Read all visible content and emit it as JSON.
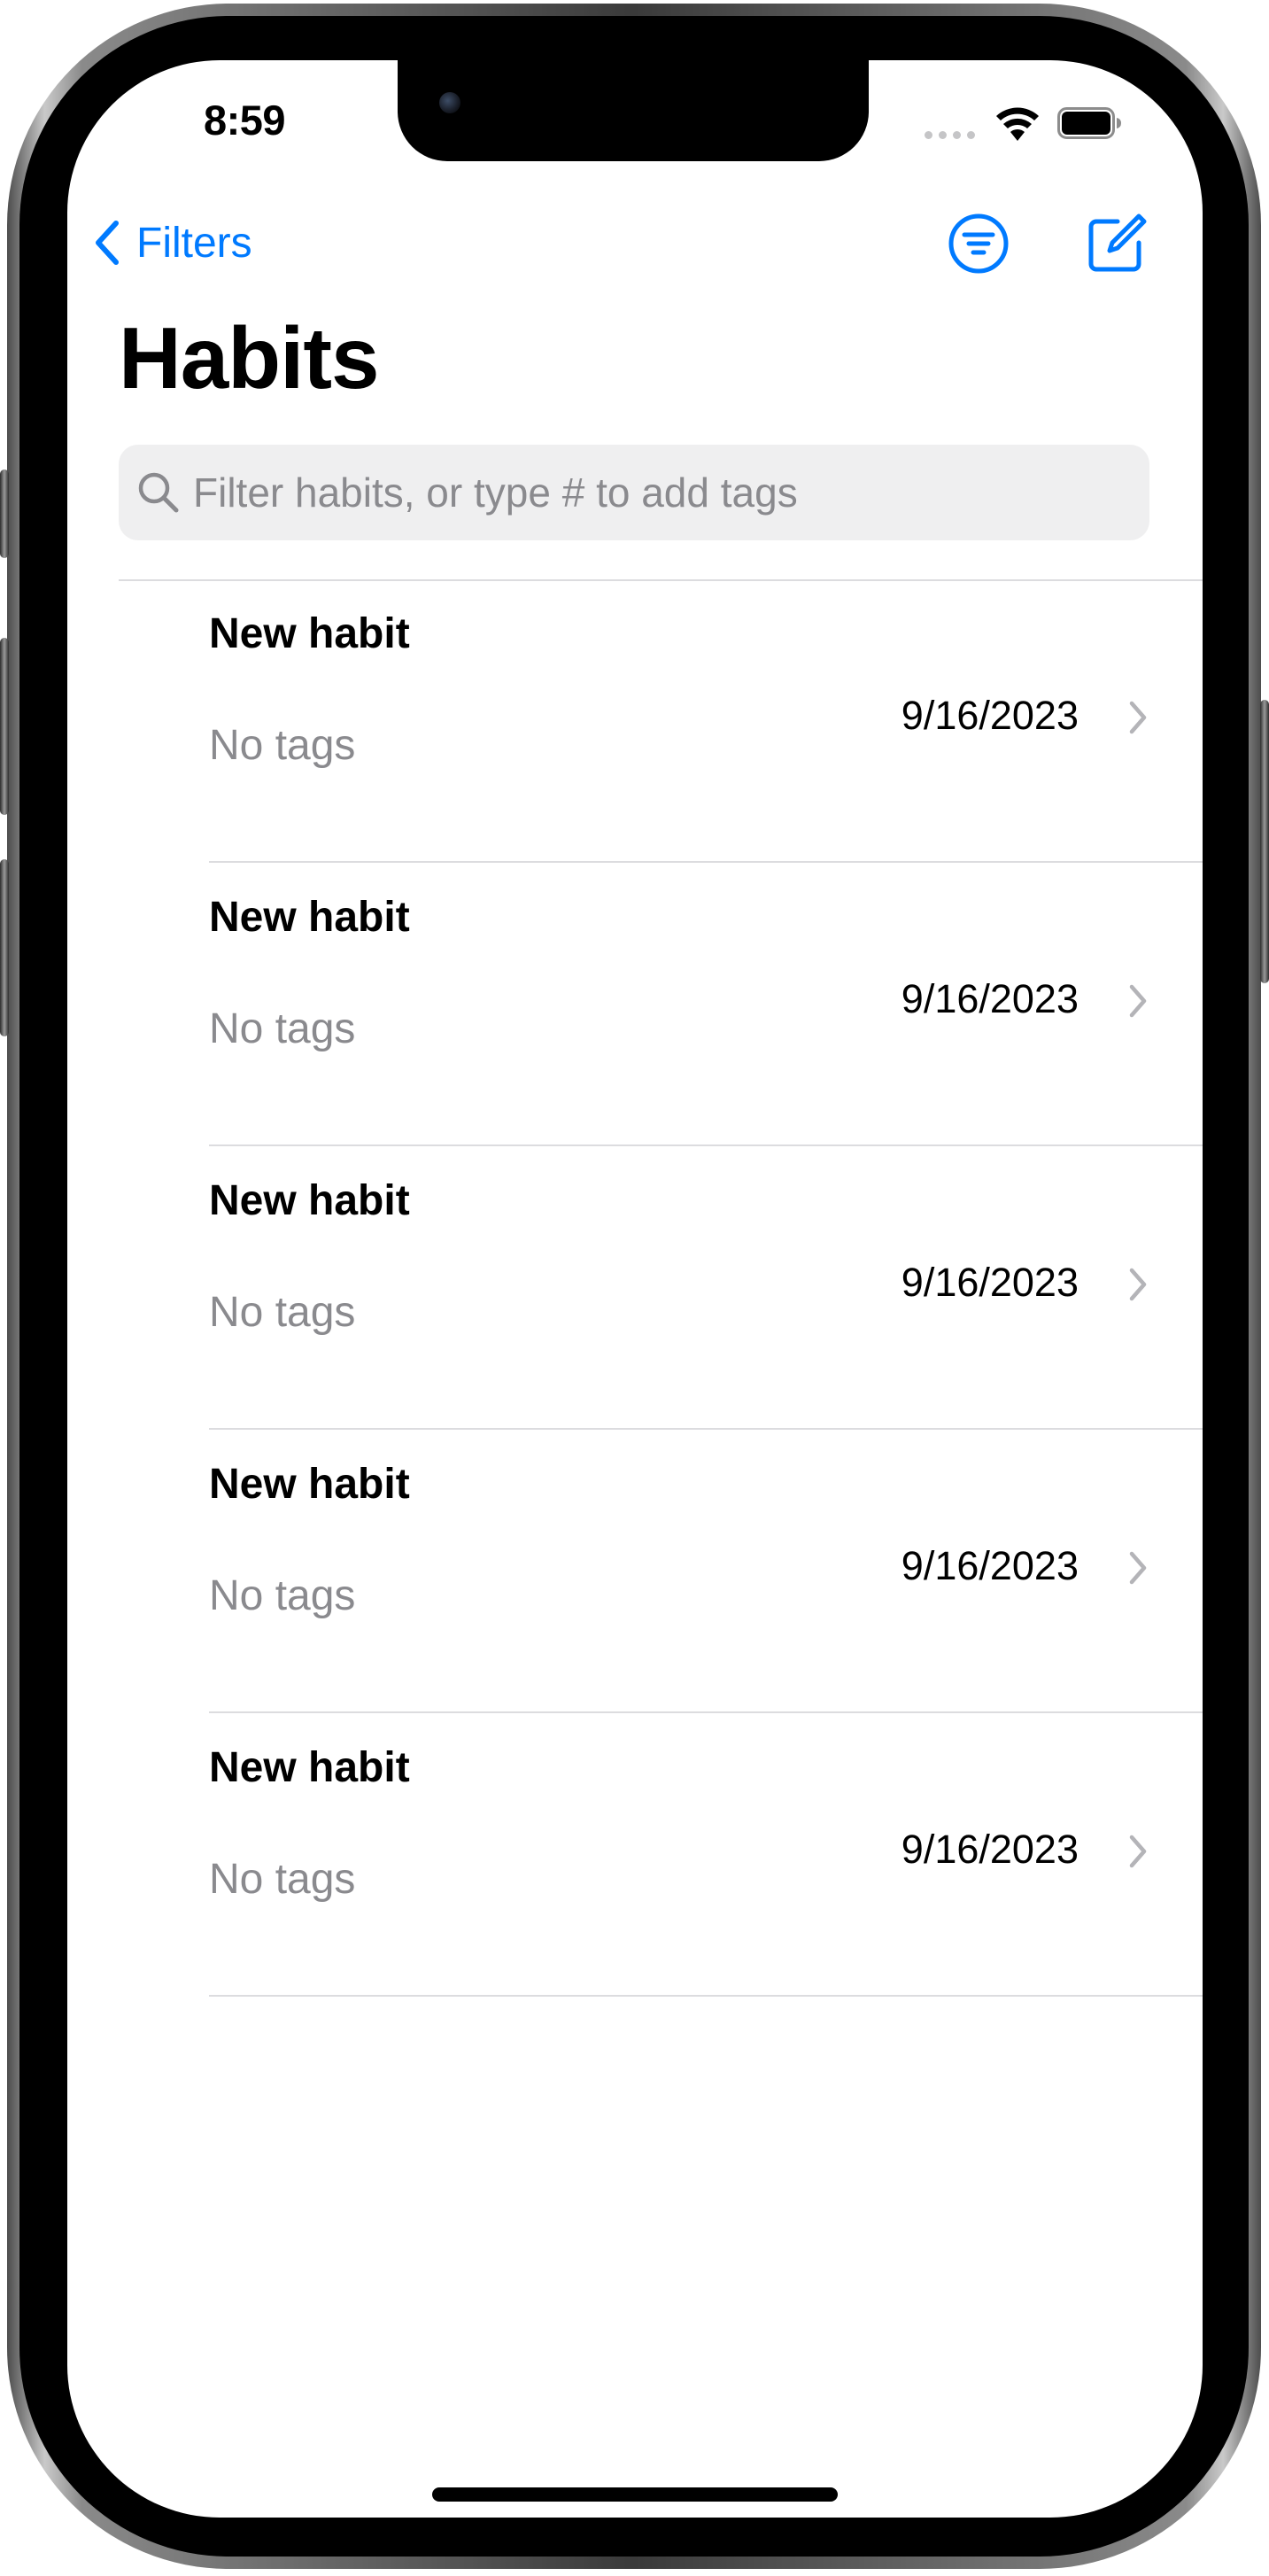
{
  "status_bar": {
    "time": "8:59"
  },
  "nav": {
    "back_label": "Filters",
    "title": "Habits"
  },
  "search": {
    "placeholder": "Filter habits, or type # to add tags",
    "value": ""
  },
  "habits": [
    {
      "title": "New habit",
      "tags": "No tags",
      "date": "9/16/2023"
    },
    {
      "title": "New habit",
      "tags": "No tags",
      "date": "9/16/2023"
    },
    {
      "title": "New habit",
      "tags": "No tags",
      "date": "9/16/2023"
    },
    {
      "title": "New habit",
      "tags": "No tags",
      "date": "9/16/2023"
    },
    {
      "title": "New habit",
      "tags": "No tags",
      "date": "9/16/2023"
    }
  ],
  "icons": {
    "back": "chevron-left-icon",
    "filter": "line-3-horizontal-decrease-circle-icon",
    "compose": "square-and-pencil-icon",
    "search": "magnifyingglass-icon",
    "row_disclosure": "chevron-right-icon",
    "wifi": "wifi-icon",
    "battery": "battery-full-icon"
  },
  "colors": {
    "accent": "#007aff",
    "secondary_text": "#8a8a8e",
    "separator": "#dcdcdf",
    "search_background": "#efeff0"
  }
}
